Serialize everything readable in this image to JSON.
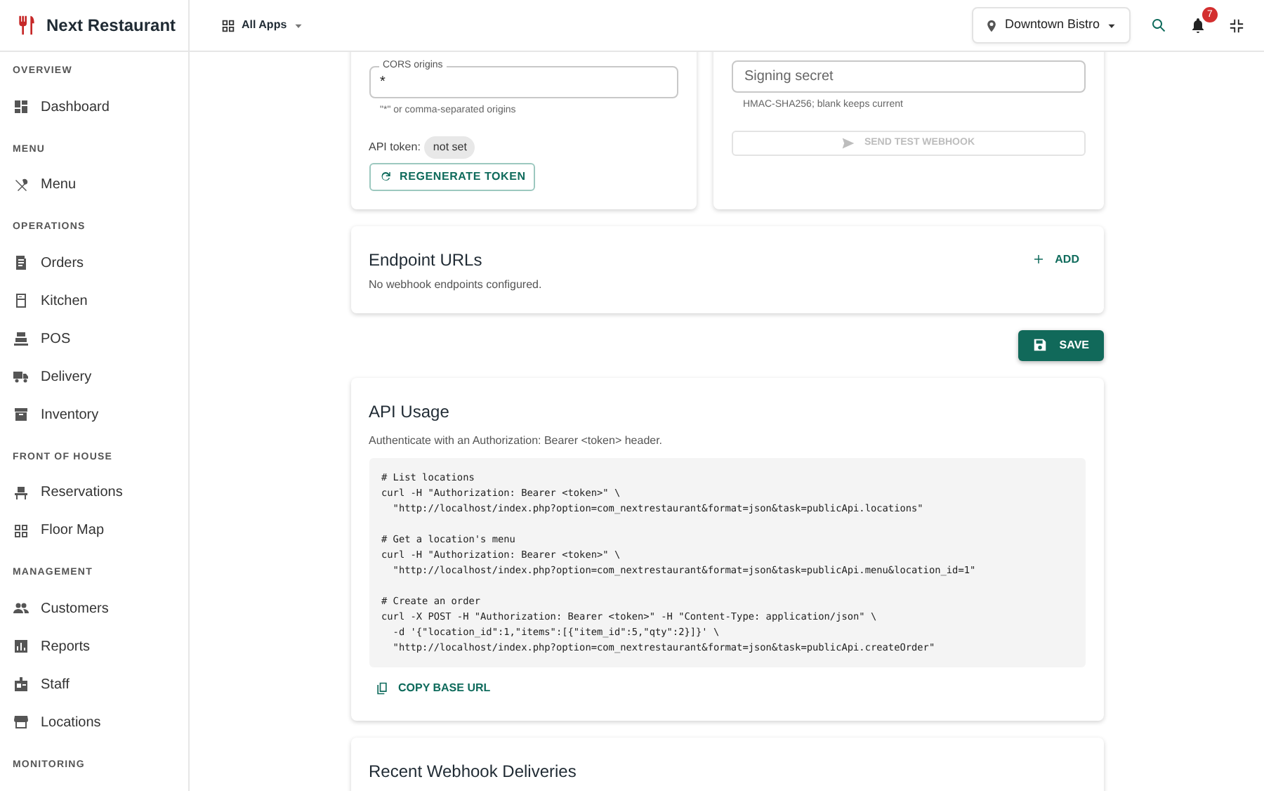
{
  "app": {
    "title": "Next Restaurant",
    "apps_menu": "All Apps",
    "location": "Downtown Bistro",
    "notifications": "7"
  },
  "sidebar": {
    "sections": [
      {
        "label": "OVERVIEW",
        "items": [
          {
            "label": "Dashboard",
            "selected": false
          }
        ]
      },
      {
        "label": "MENU",
        "items": [
          {
            "label": "Menu",
            "selected": false
          }
        ]
      },
      {
        "label": "OPERATIONS",
        "items": [
          {
            "label": "Orders",
            "selected": false
          },
          {
            "label": "Kitchen",
            "selected": false
          },
          {
            "label": "POS",
            "selected": false
          },
          {
            "label": "Delivery",
            "selected": false
          },
          {
            "label": "Inventory",
            "selected": false
          }
        ]
      },
      {
        "label": "FRONT OF HOUSE",
        "items": [
          {
            "label": "Reservations",
            "selected": false
          },
          {
            "label": "Floor Map",
            "selected": false
          }
        ]
      },
      {
        "label": "MANAGEMENT",
        "items": [
          {
            "label": "Customers",
            "selected": false
          },
          {
            "label": "Reports",
            "selected": false
          },
          {
            "label": "Staff",
            "selected": false
          },
          {
            "label": "Locations",
            "selected": false
          }
        ]
      },
      {
        "label": "MONITORING"
      }
    ]
  },
  "api_card": {
    "cors_field": {
      "label": "CORS origins",
      "value": "*",
      "helper": "\"*\" or comma-separated origins"
    },
    "token_label": "API token:",
    "token_chip": "not set",
    "regenerate_button": "REGENERATE TOKEN"
  },
  "webhook_card": {
    "secret_field": {
      "placeholder": "Signing secret",
      "helper": "HMAC-SHA256; blank keeps current"
    },
    "test_button": {
      "label": "SEND TEST WEBHOOK",
      "disabled": true
    }
  },
  "endpoints": {
    "title": "Endpoint URLs",
    "add_button": "ADD",
    "empty_text": "No webhook endpoints configured."
  },
  "save_button": "SAVE",
  "api_usage": {
    "title": "API Usage",
    "subtitle": "Authenticate with an Authorization: Bearer <token> header.",
    "code_blocks": [
      [
        "# List locations",
        "curl -H \"Authorization: Bearer <token>\" \\",
        "  \"http://localhost/index.php?option=com_nextrestaurant&format=json&task=publicApi.locations\""
      ],
      [
        "# Get a location's menu",
        "curl -H \"Authorization: Bearer <token>\" \\",
        "  \"http://localhost/index.php?option=com_nextrestaurant&format=json&task=publicApi.menu&location_id=1\""
      ],
      [
        "# Create an order",
        "curl -X POST -H \"Authorization: Bearer <token>\" -H \"Content-Type: application/json\" \\",
        "  -d '{\"location_id\":1,\"items\":[{\"item_id\":5,\"qty\":2}]}' \\",
        "  \"http://localhost/index.php?option=com_nextrestaurant&format=json&task=publicApi.createOrder\""
      ]
    ],
    "copy_button": "COPY BASE URL"
  },
  "deliveries": {
    "title": "Recent Webhook Deliveries"
  }
}
